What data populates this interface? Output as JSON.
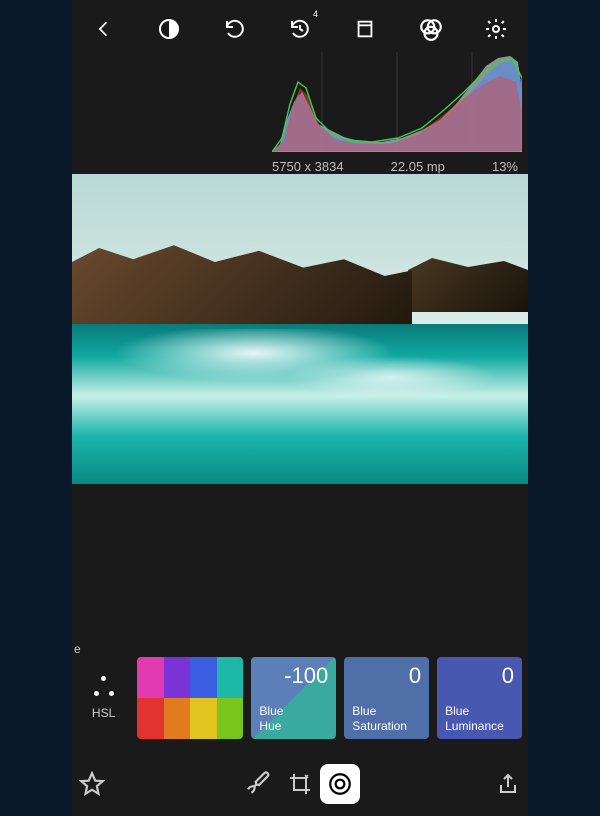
{
  "toolbar": {
    "back": "back-icon",
    "compare": "compare-icon",
    "undo": "undo-icon",
    "history": "history-icon",
    "history_badge": "4",
    "aspect": "aspect-icon",
    "channels": "channels-icon",
    "settings": "settings-icon"
  },
  "histogram": {
    "dimensions": "5750 x 3834",
    "megapixels": "22.05 mp",
    "zoom": "13%"
  },
  "preview": {
    "description": "Rocky coastline with turquoise ocean waves"
  },
  "adjust": {
    "group_label_partial_left": "e",
    "group_label": "HSL",
    "swatch_colors": [
      "#e23ab0",
      "#7a33d6",
      "#3a5de2",
      "#1eb8a8",
      "#e2332e",
      "#e27a1e",
      "#e2c41e",
      "#7ac41e"
    ],
    "cards": [
      {
        "value": "-100",
        "label_line1": "Blue",
        "label_line2": "Hue",
        "kind": "hue"
      },
      {
        "value": "0",
        "label_line1": "Blue",
        "label_line2": "Saturation",
        "kind": "sat"
      },
      {
        "value": "0",
        "label_line1": "Blue",
        "label_line2": "Luminance",
        "kind": "lum"
      }
    ]
  },
  "bottombar": {
    "favorite": "star-icon",
    "brush": "brush-icon",
    "crop": "crop-icon",
    "adjust": "adjust-icon",
    "share": "share-icon"
  }
}
